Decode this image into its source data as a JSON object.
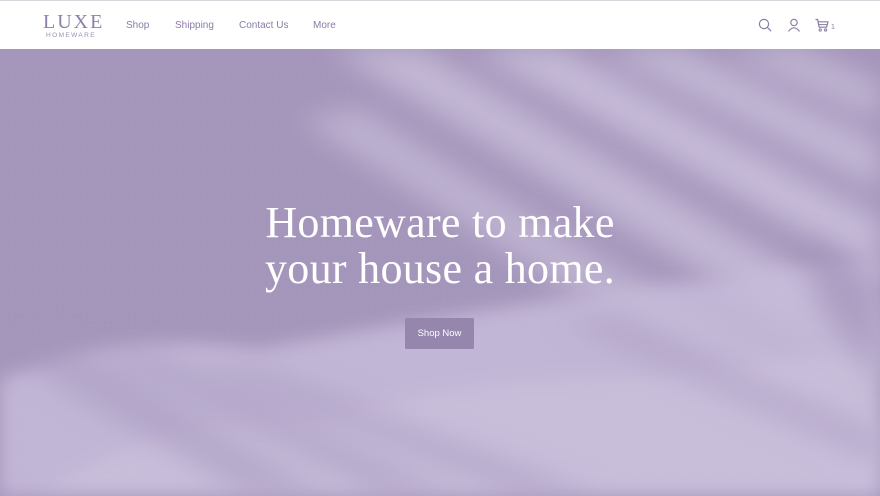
{
  "brand": {
    "name": "LUXE",
    "tagline": "HOMEWARE"
  },
  "nav": {
    "items": [
      {
        "label": "Shop"
      },
      {
        "label": "Shipping"
      },
      {
        "label": "Contact Us"
      },
      {
        "label": "More"
      }
    ]
  },
  "header_icons": {
    "search": "search-icon",
    "account": "user-icon",
    "cart": "cart-icon",
    "cart_count": "1"
  },
  "hero": {
    "headline_line1": "Homeware to make",
    "headline_line2": "your house a home.",
    "cta_label": "Shop Now"
  },
  "colors": {
    "accent": "#9486ad",
    "nav_text": "#8a7ca5",
    "hero_tint": "#b3a6c6"
  }
}
